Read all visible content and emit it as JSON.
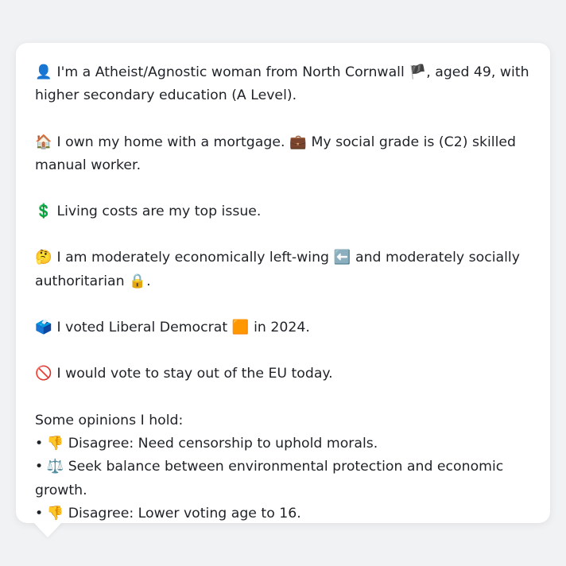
{
  "persona": {
    "intro": {
      "icon": "👤",
      "text_a": "I'm a Atheist/Agnostic woman from North Cornwall",
      "flag": "🏴",
      "text_b": ", aged 49, with higher secondary education (A Level)."
    },
    "housing": {
      "icon": "🏠",
      "text_a": "I own my home with a mortgage.",
      "icon2": "💼",
      "text_b": "My social grade is (C2) skilled manual worker."
    },
    "issue": {
      "icon": "💲",
      "text": "Living costs are my top issue."
    },
    "ideology": {
      "icon": "🤔",
      "text_a": "I am moderately economically left-wing",
      "icon2": "⬅️",
      "text_b": "and moderately socially authoritarian",
      "icon3": "🔒",
      "text_c": "."
    },
    "vote": {
      "icon": "🗳️",
      "text_a": "I voted Liberal Democrat",
      "party_icon": "🟧",
      "text_b": "in 2024."
    },
    "eu": {
      "icon": "🚫",
      "text": "I would vote to stay out of the EU today."
    },
    "opinions": {
      "heading": "Some opinions I hold:",
      "bullet": "•",
      "items": [
        {
          "icon": "👎",
          "text": "Disagree: Need censorship to uphold morals."
        },
        {
          "icon": "⚖️",
          "text": "Seek balance between environmental protection and economic growth."
        },
        {
          "icon": "👎",
          "text": "Disagree: Lower voting age to 16."
        }
      ]
    }
  }
}
